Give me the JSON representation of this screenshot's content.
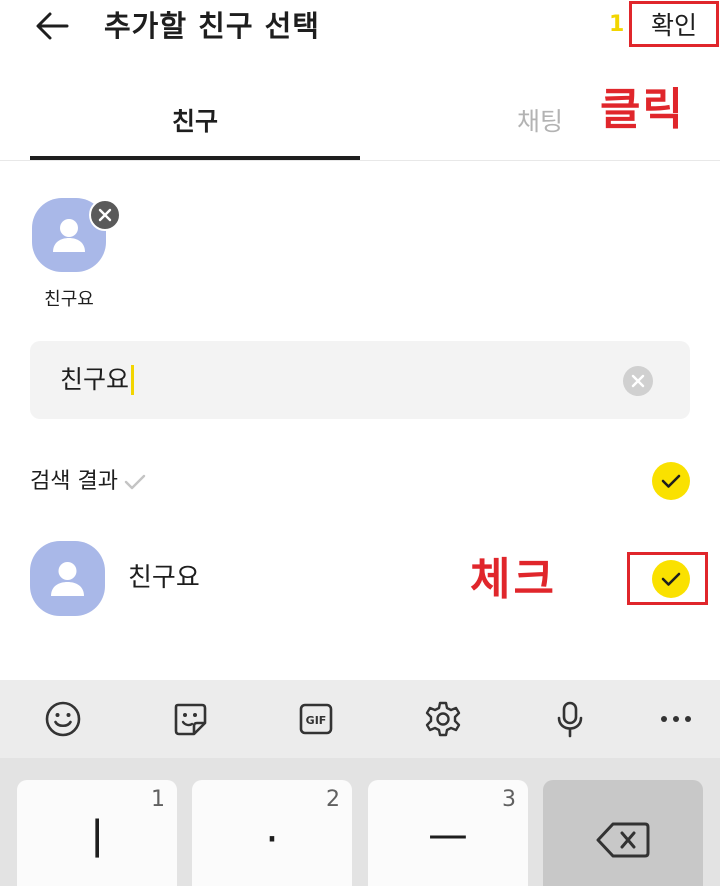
{
  "header": {
    "title": "추가할 친구 선택",
    "selected_count": "1",
    "confirm_label": "확인"
  },
  "tabs": [
    {
      "label": "친구",
      "active": true
    },
    {
      "label": "채팅",
      "active": false
    }
  ],
  "annotations": {
    "click": "클릭",
    "check": "체크"
  },
  "selected": [
    {
      "name": "친구요"
    }
  ],
  "search": {
    "value": "친구요"
  },
  "results": {
    "label": "검색 결과",
    "items": [
      {
        "name": "친구요",
        "checked": true
      }
    ]
  },
  "keyboard": {
    "toolbar": [
      "emoji-icon",
      "sticker-icon",
      "gif-icon",
      "settings-icon",
      "microphone-icon",
      "more-icon"
    ],
    "gif_label": "GIF",
    "keys": [
      {
        "num": "1",
        "glyph": "ㅣ"
      },
      {
        "num": "2",
        "glyph": "·"
      },
      {
        "num": "3",
        "glyph": "ㅡ"
      }
    ]
  },
  "colors": {
    "accent_yellow": "#fae100",
    "annotation_red": "#e0262b",
    "avatar_blue": "#a9b8e8"
  }
}
